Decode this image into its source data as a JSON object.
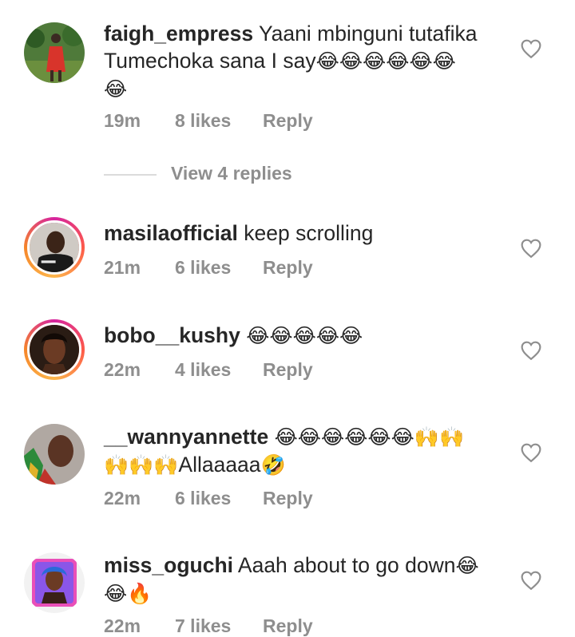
{
  "comments": [
    {
      "username": "faigh_empress",
      "text_line1": "Yaani mbinguni tutafika",
      "text_line2": "Tumechoka sana I say",
      "emoji_line2": "😂😂😂😂😂😂",
      "emoji_line3": "😂",
      "time": "19m",
      "likes": "8 likes",
      "reply": "Reply"
    },
    {
      "username": "masilaofficial",
      "text": "keep scrolling",
      "time": "21m",
      "likes": "6 likes",
      "reply": "Reply"
    },
    {
      "username": "bobo__kushy",
      "emoji": "😂😂😂😂😂",
      "time": "22m",
      "likes": "4 likes",
      "reply": "Reply"
    },
    {
      "username": "__wannyannette",
      "emoji_line1": "😂😂😂😂😂😂🙌🙌",
      "emoji_line2a": "🙌🙌🙌",
      "text_line2": "Allaaaaa",
      "emoji_line2b": "🤣",
      "time": "22m",
      "likes": "6 likes",
      "reply": "Reply"
    },
    {
      "username": "miss_oguchi",
      "text_line1": "Aaah about to go down",
      "emoji_line1": "😂",
      "emoji_line2": "😂🔥",
      "time": "22m",
      "likes": "7 likes",
      "reply": "Reply"
    }
  ],
  "view_replies": "View 4 replies",
  "icons": {
    "like": "heart-outline-icon"
  },
  "colors": {
    "text": "#262626",
    "meta": "#8e8e8e",
    "divider": "#dbdbdb"
  }
}
